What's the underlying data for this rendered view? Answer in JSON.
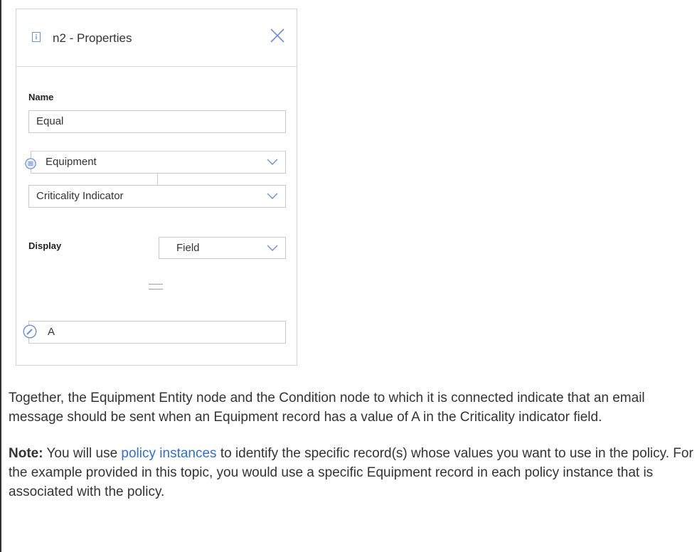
{
  "panel": {
    "title": "n2 - Properties",
    "icons": {
      "header": "info-document-icon",
      "close": "close-icon"
    },
    "name_label": "Name",
    "name_value": "Equal",
    "entity_dropdown": "Equipment",
    "field_dropdown": "Criticality Indicator",
    "display_label": "Display",
    "display_dropdown": "Field",
    "operator": "=",
    "value_input": "A",
    "accent_color": "#6a8fd8"
  },
  "content": {
    "paragraph1": "Together, the Equipment Entity node and the Condition node to which it is connected indicate that an email message should be sent when an Equipment record has a value of A in the Criticality indicator field.",
    "note_label": "Note:",
    "note_text_before": " You will use ",
    "note_link": "policy instances",
    "note_text_after": " to identify the specific record(s) whose values you want to use in the policy. For the example provided in this topic, you would use a specific Equipment record in each policy instance that is associated with the policy.",
    "link_color": "#2f6ed8"
  }
}
